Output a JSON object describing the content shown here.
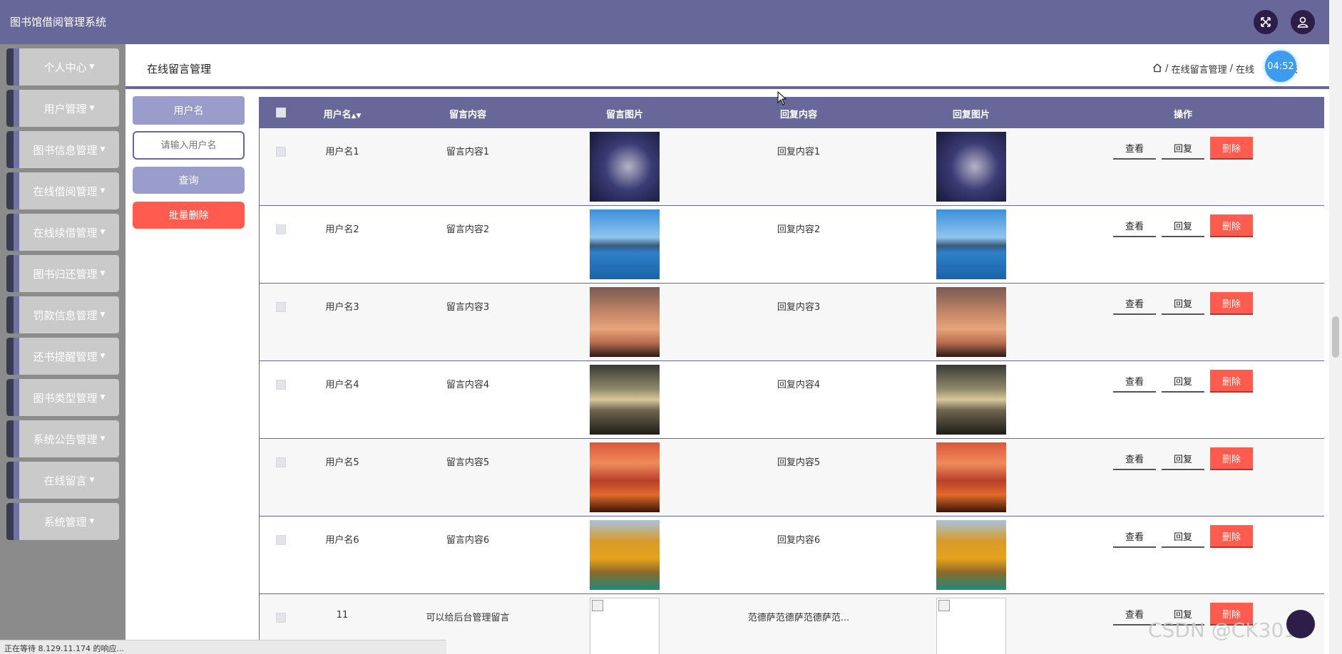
{
  "app": {
    "title": "图书馆借阅管理系统"
  },
  "sidebar": {
    "items": [
      {
        "label": "个人中心"
      },
      {
        "label": "用户管理"
      },
      {
        "label": "图书信息管理"
      },
      {
        "label": "在线借阅管理"
      },
      {
        "label": "在线续借管理"
      },
      {
        "label": "图书归还管理"
      },
      {
        "label": "罚款信息管理"
      },
      {
        "label": "还书提醒管理"
      },
      {
        "label": "图书类型管理"
      },
      {
        "label": "系统公告管理"
      },
      {
        "label": "在线留言"
      },
      {
        "label": "系统管理"
      }
    ]
  },
  "header": {
    "page_title": "在线留言管理",
    "breadcrumb": {
      "part1": "在线留言管理",
      "part2": "在线",
      "part3": "表"
    },
    "timer": "04:52"
  },
  "filters": {
    "label": "用户名",
    "input_placeholder": "请输入用户名",
    "query_label": "查询",
    "batch_delete_label": "批量删除"
  },
  "table": {
    "headers": {
      "username": "用户名",
      "sort_icon": "sort-arrows-icon",
      "content": "留言内容",
      "image": "留言图片",
      "reply": "回复内容",
      "reply_image": "回复图片",
      "ops": "操作"
    },
    "action_labels": {
      "view": "查看",
      "reply": "回复",
      "delete": "删除"
    },
    "rows": [
      {
        "username": "用户名1",
        "content": "留言内容1",
        "reply": "回复内容1"
      },
      {
        "username": "用户名2",
        "content": "留言内容2",
        "reply": "回复内容2"
      },
      {
        "username": "用户名3",
        "content": "留言内容3",
        "reply": "回复内容3"
      },
      {
        "username": "用户名4",
        "content": "留言内容4",
        "reply": "回复内容4"
      },
      {
        "username": "用户名5",
        "content": "留言内容5",
        "reply": "回复内容5"
      },
      {
        "username": "用户名6",
        "content": "留言内容6",
        "reply": "回复内容6"
      },
      {
        "username": "11",
        "content": "可以给后台管理留言",
        "reply": "范德萨范德萨范德萨范..."
      }
    ]
  },
  "status_bar": {
    "text": "正在等待 8.129.11.174 的响应..."
  },
  "watermark": "CSDN @CK3011",
  "colors": {
    "primary": "#676899",
    "accent": "#9a9ccb",
    "danger": "#ff5c4f",
    "dark_icon": "#2d1d49"
  }
}
